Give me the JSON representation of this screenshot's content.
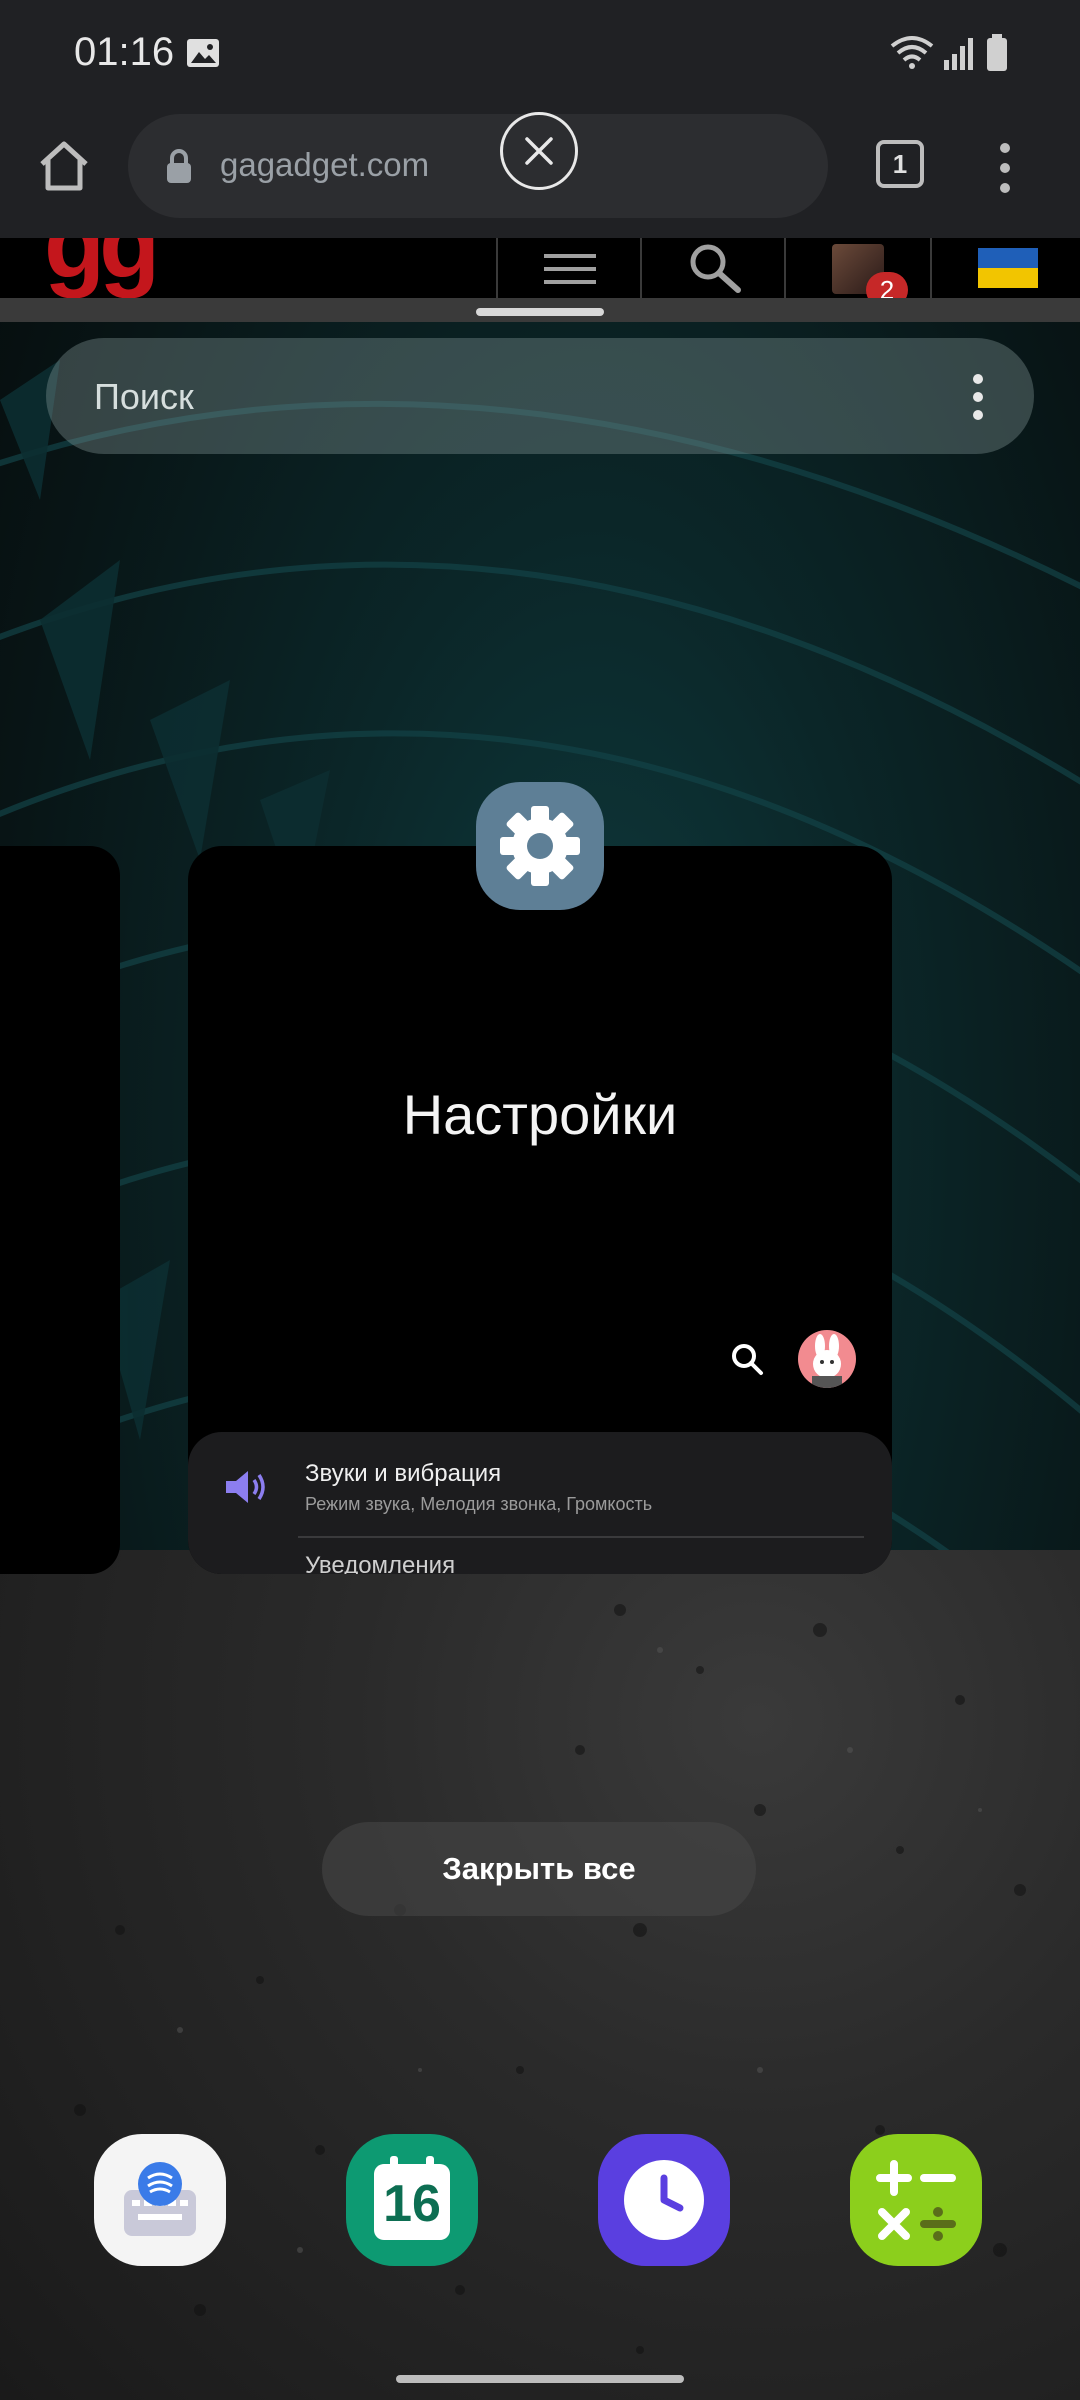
{
  "status_bar": {
    "time": "01:16"
  },
  "browser": {
    "url": "gagadget.com",
    "tab_count": "1",
    "site_logo": "gg",
    "notification_count": "2"
  },
  "recents": {
    "search_placeholder": "Поиск",
    "card": {
      "app_name": "Настройки",
      "item_title": "Звуки и вибрация",
      "item_subtitle": "Режим звука, Мелодия звонка, Громкость",
      "next_item_partial": "Уведомления"
    },
    "close_all_label": "Закрыть все"
  },
  "dock": {
    "calendar_day": "16"
  },
  "colors": {
    "settings_icon": "#5e7f96",
    "site_logo": "#c4161c",
    "calendar": "#0d9a72",
    "clock": "#5a3fe0",
    "calculator": "#8ccf1c"
  }
}
